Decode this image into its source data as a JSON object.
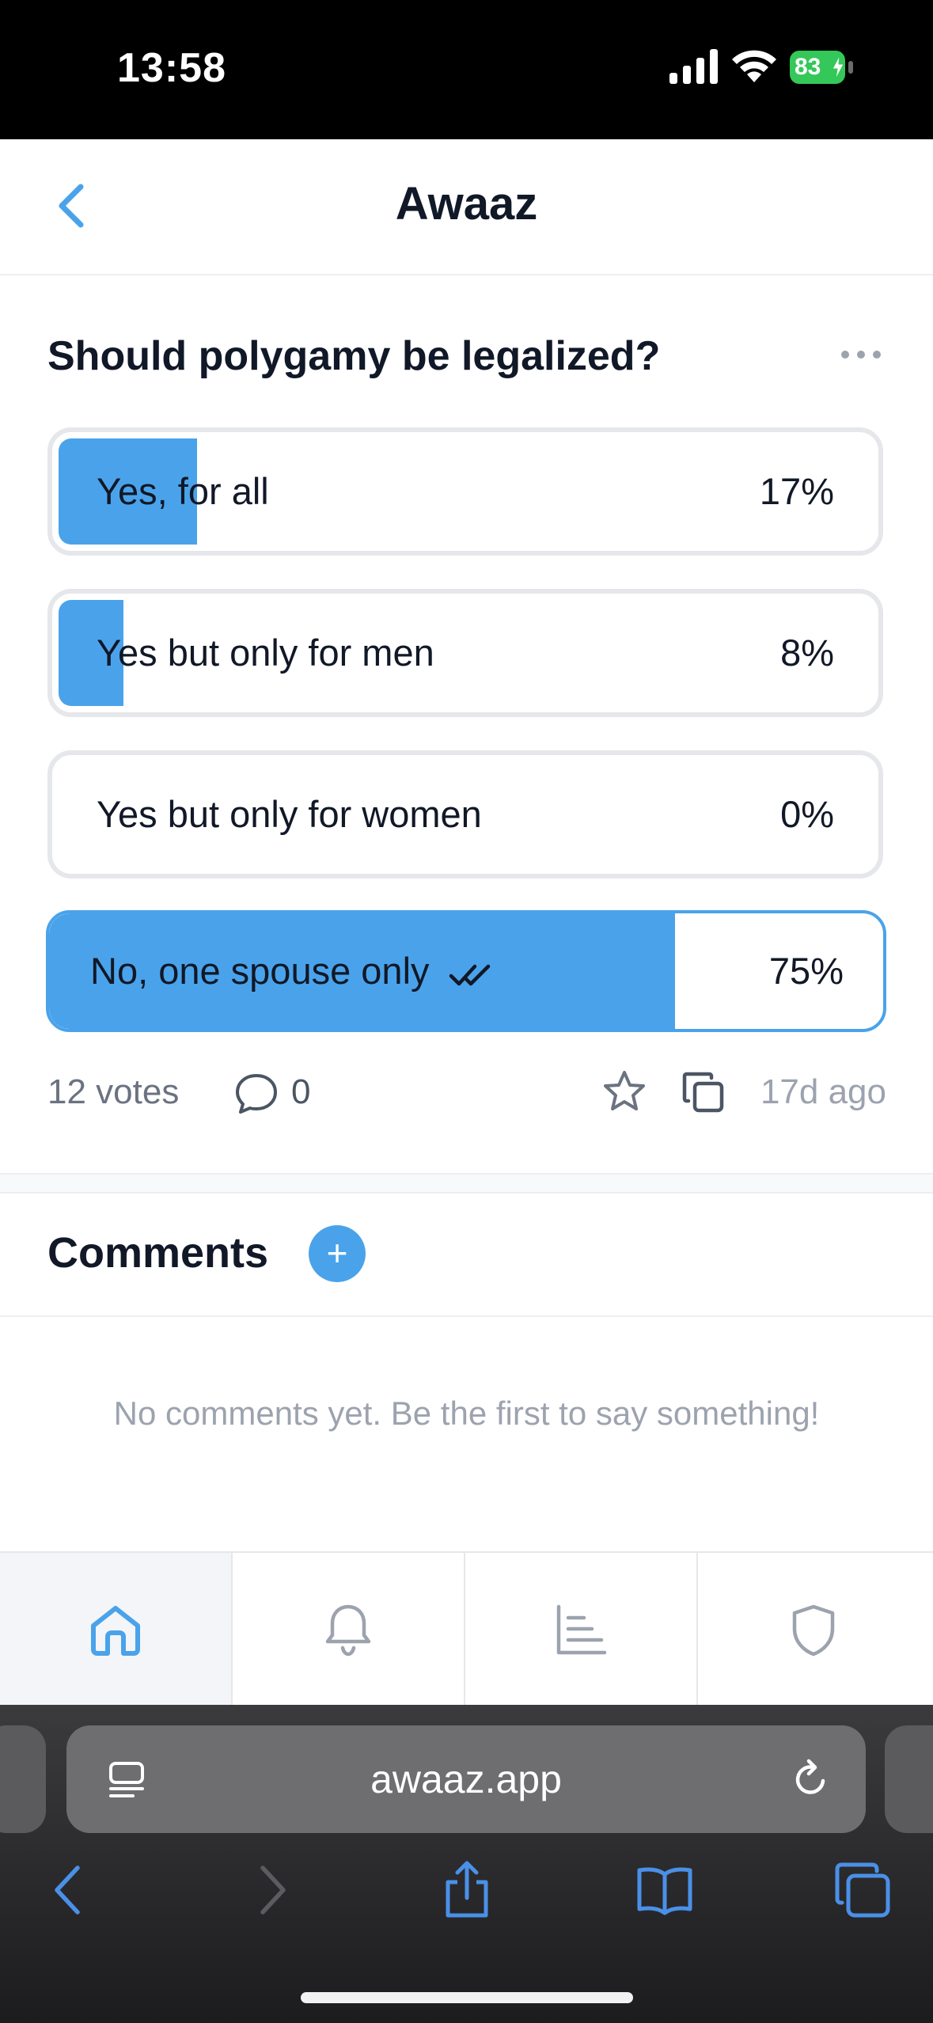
{
  "status_bar": {
    "time": "13:58",
    "battery": "83"
  },
  "header": {
    "title": "Awaaz"
  },
  "poll": {
    "question": "Should polygamy be legalized?",
    "options": [
      {
        "label": "Yes, for all",
        "percent_text": "17%",
        "percent": 17,
        "selected": false
      },
      {
        "label": "Yes but only for men",
        "percent_text": "8%",
        "percent": 8,
        "selected": false
      },
      {
        "label": "Yes but only for women",
        "percent_text": "0%",
        "percent": 0,
        "selected": false
      },
      {
        "label": "No, one spouse only",
        "percent_text": "75%",
        "percent": 75,
        "selected": true
      }
    ],
    "votes": "12 votes",
    "comment_count": "0",
    "time_ago": "17d ago"
  },
  "comments": {
    "title": "Comments",
    "add_label": "+",
    "empty_text": "No comments yet. Be the first to say something!"
  },
  "tab_bar": {
    "items": [
      {
        "icon": "home-icon",
        "active": true
      },
      {
        "icon": "bell-icon",
        "active": false
      },
      {
        "icon": "chart-icon",
        "active": false
      },
      {
        "icon": "shield-icon",
        "active": false
      }
    ]
  },
  "browser": {
    "url": "awaaz.app"
  },
  "colors": {
    "accent": "#4aa3ea",
    "inactive_icon": "#9ca3af",
    "text": "#111827"
  }
}
